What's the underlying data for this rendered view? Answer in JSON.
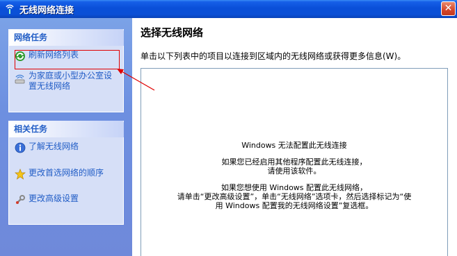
{
  "window": {
    "title": "无线网络连接",
    "close_label": "✕"
  },
  "network_tasks": {
    "header": "网络任务",
    "items": [
      {
        "label": "刷新网络列表",
        "icon": "refresh-icon"
      },
      {
        "label": "为家庭或小型办公室设置无线网络",
        "icon": "home-network-icon"
      }
    ]
  },
  "related_tasks": {
    "header": "相关任务",
    "items": [
      {
        "label": "了解无线网络",
        "icon": "info-icon"
      },
      {
        "label": "更改首选网络的顺序",
        "icon": "star-icon"
      },
      {
        "label": "更改高级设置",
        "icon": "settings-icon"
      }
    ]
  },
  "main": {
    "title": "选择无线网络",
    "description": "单击以下列表中的项目以连接到区域内的无线网络或获得更多信息(W)。",
    "message": {
      "line1": "Windows 无法配置此无线连接",
      "line2": "如果您已经启用其他程序配置此无线连接，",
      "line3": "请使用该软件。",
      "line4": "如果您想使用 Windows 配置此无线网络，",
      "line5": "请单击“更改高级设置”，单击“无线网络”选项卡，然后选择标记为“使",
      "line6": "用 Windows 配置我的无线网络设置”复选框。"
    }
  },
  "colors": {
    "titlebar": "#0a4fd8",
    "task_link": "#215dc6",
    "annotation": "#e00000"
  }
}
